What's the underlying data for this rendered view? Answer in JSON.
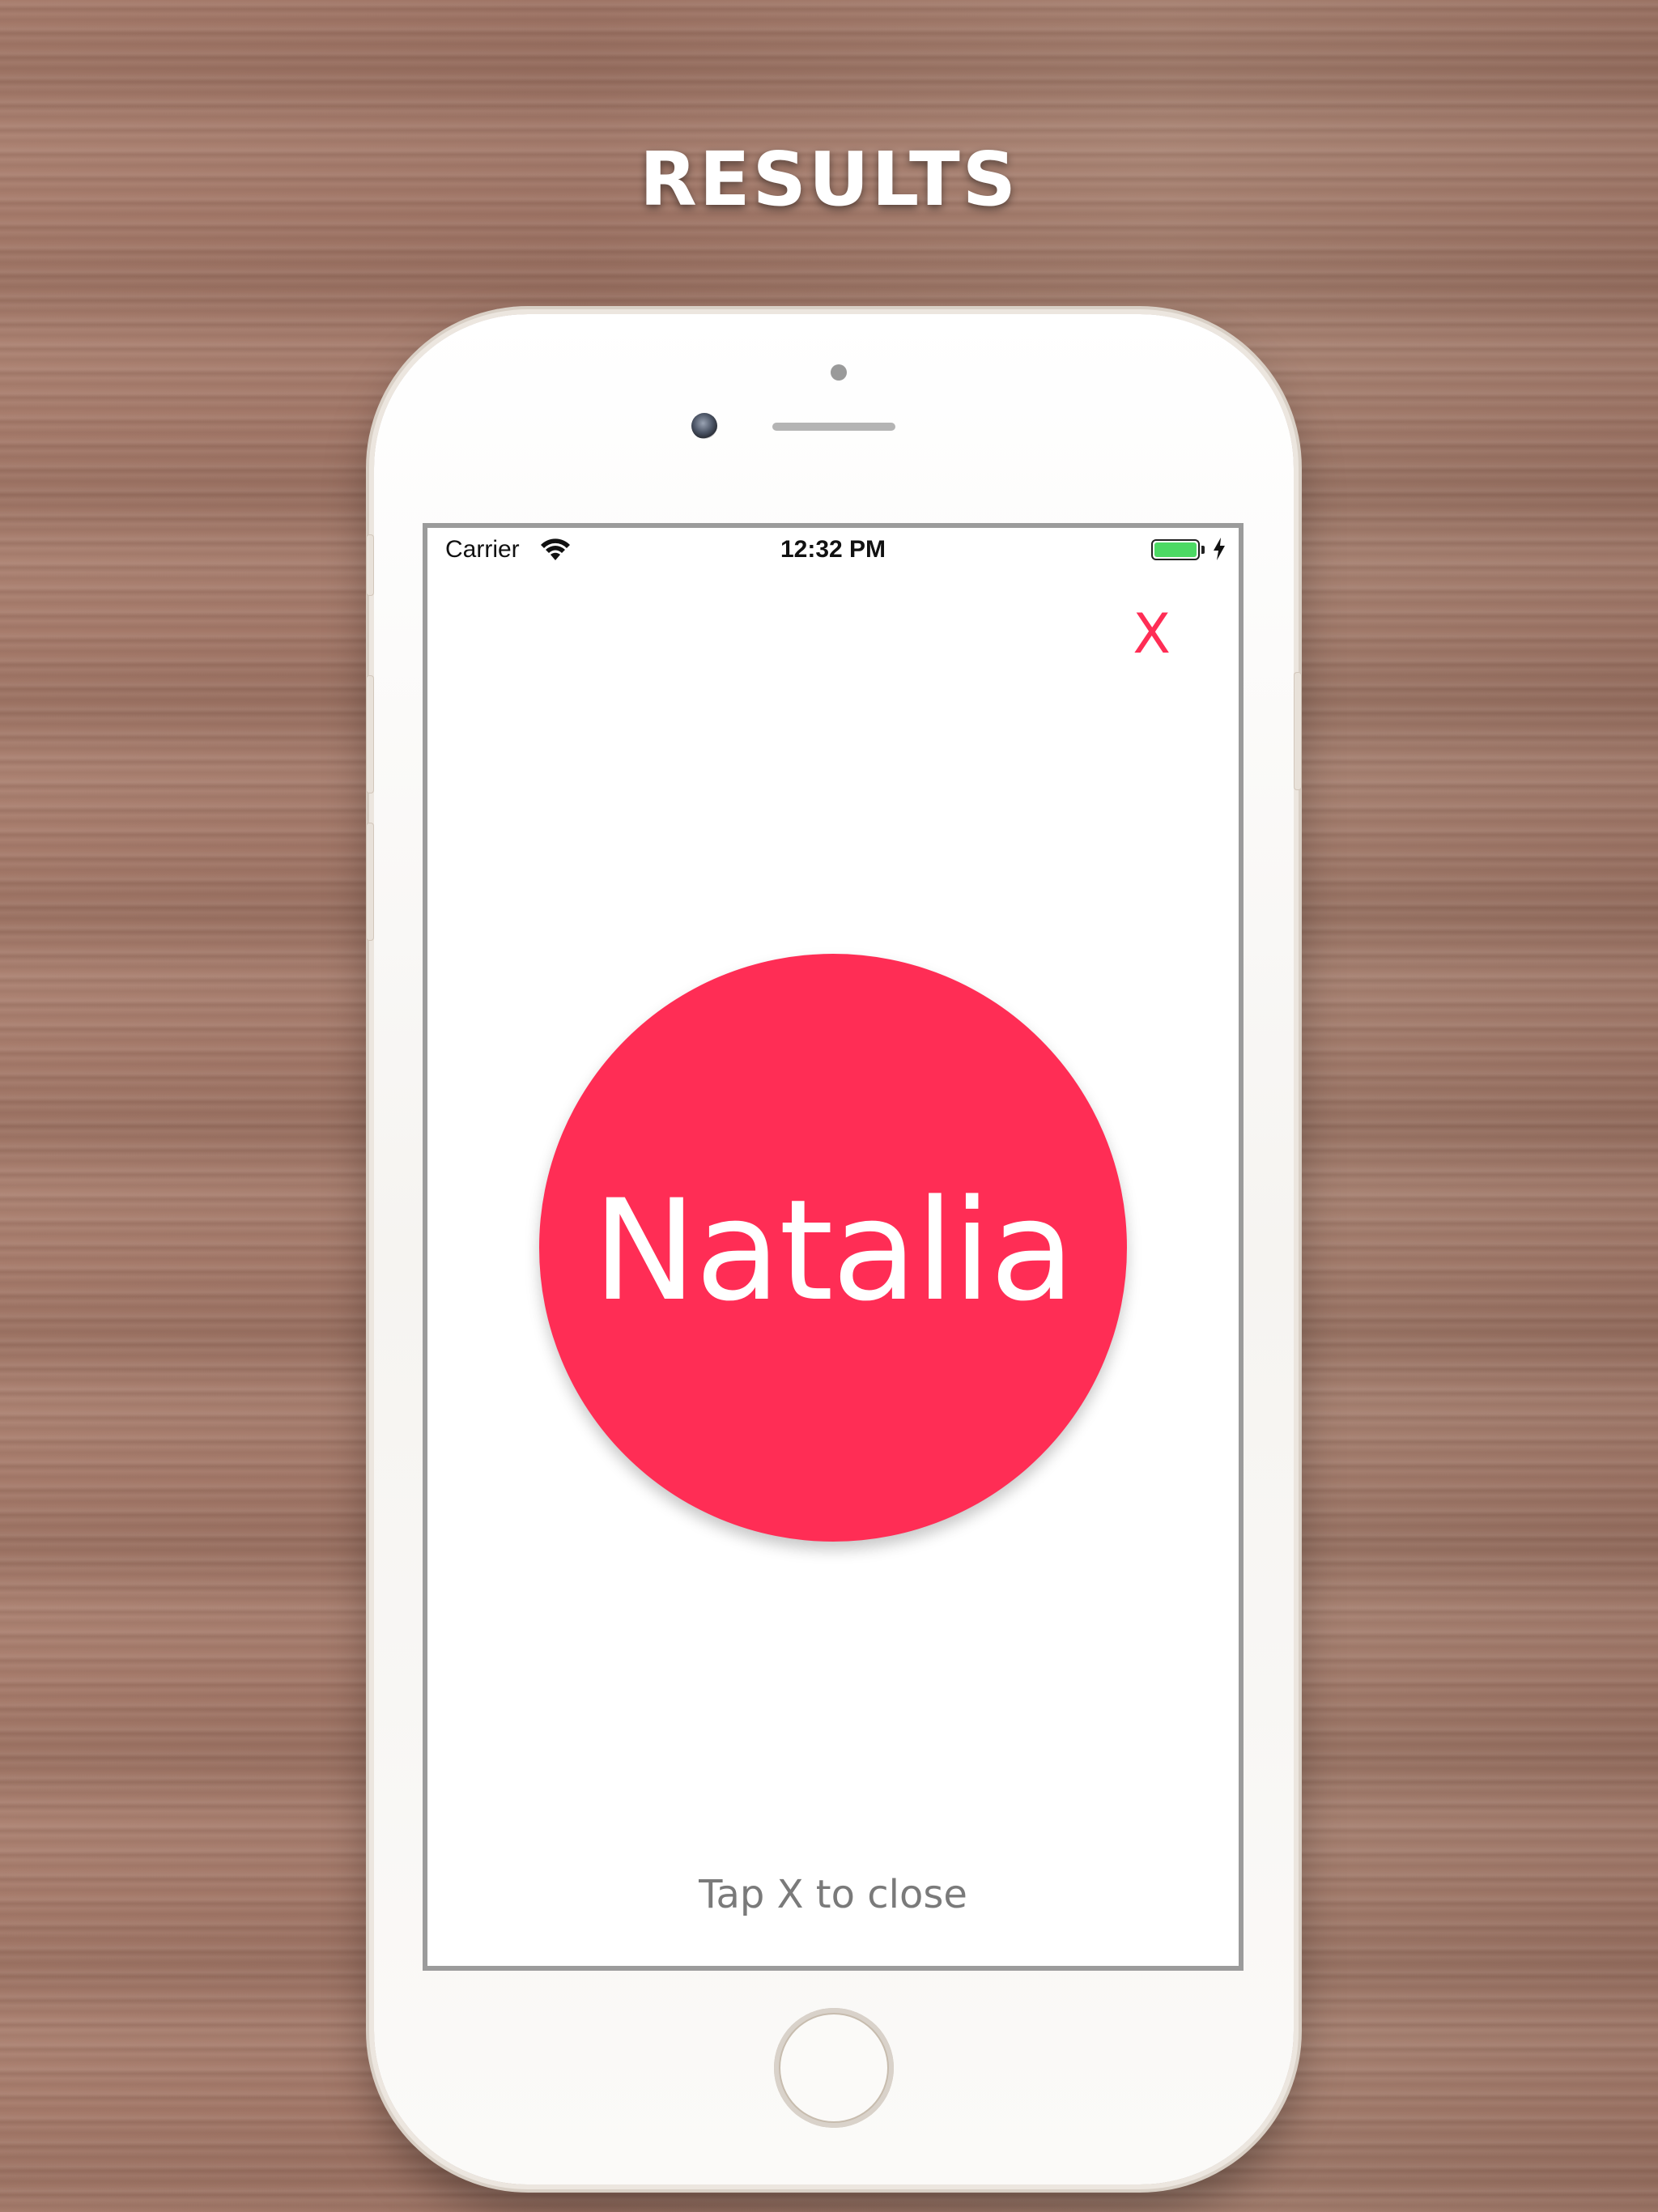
{
  "headline": "RESULTS",
  "status_bar": {
    "carrier": "Carrier",
    "time": "12:32 PM",
    "battery_color": "#4cd964"
  },
  "screen": {
    "close_label": "X",
    "accent_color": "#ff2d55",
    "result_name": "Natalia",
    "hint": "Tap X to close"
  },
  "icons": [
    "wifi-icon",
    "battery-icon",
    "charging-bolt-icon",
    "home-button"
  ]
}
